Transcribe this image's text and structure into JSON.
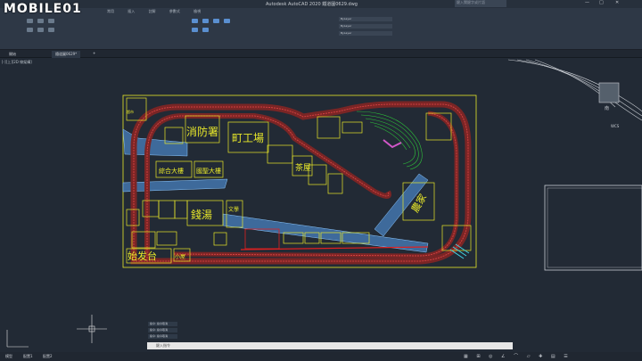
{
  "window": {
    "title": "Autodesk AutoCAD 2020 鐵道圖0629.dwg",
    "search_placeholder": "鍵入關鍵字或片語"
  },
  "ribbon": {
    "tabs": [
      "常用",
      "插入",
      "註解",
      "參數式",
      "檢視",
      "管理",
      "輸出",
      "增益集",
      "協同合作",
      "精選應用程式"
    ],
    "panels": [
      "繪製",
      "修改",
      "註解",
      "圖層",
      "圖塊",
      "性質",
      "群組",
      "公用程式",
      "剪貼簿",
      "檢視"
    ],
    "layer_dropdown": "ByLayer"
  },
  "doc_tabs": [
    "開始",
    "鐵道圖0629*"
  ],
  "viewport_label": "[-][上][2D 線架構]",
  "drawing": {
    "labels": [
      "消防署",
      "町工場",
      "綜合大樓",
      "國聖大樓",
      "茶屋",
      "錢湯",
      "農家",
      "始发台",
      "小屋",
      "超市",
      "文學"
    ],
    "compass": "南",
    "wcs": "WCS"
  },
  "command": {
    "history": [
      "指令: 指令取消",
      "指令: 指令取消",
      "指令: 指令取消"
    ],
    "placeholder": "鍵入指令"
  },
  "status": {
    "tabs": [
      "模型",
      "配置1",
      "配置2"
    ]
  },
  "logo_text": "MOBILE01"
}
